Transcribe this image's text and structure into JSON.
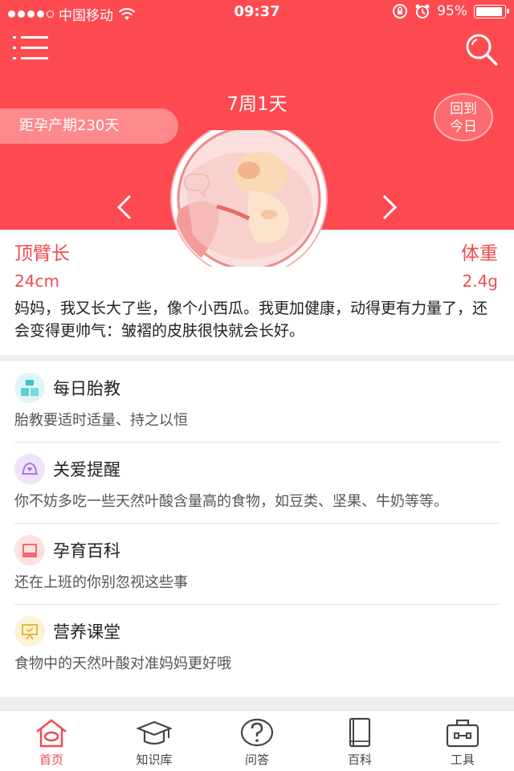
{
  "status_bar": {
    "carrier": "中国移动",
    "time": "09:37",
    "battery": "95%"
  },
  "header": {
    "week": "7周1天",
    "due_countdown": "距孕产期230天",
    "back_today": "回到今日"
  },
  "measurements": {
    "length_label": "顶臂长",
    "length_value": "24cm",
    "weight_label": "体重",
    "weight_value": "2.4g"
  },
  "description": "妈妈，我又长大了些，像个小西瓜。我更加健康，动得更有力量了，还会变得更帅气：皱褶的皮肤很快就会长好。",
  "cards": [
    {
      "title": "每日胎教",
      "subtitle": "胎教要适时适量、持之以恒",
      "icon": "building-blocks-icon",
      "color": "#37c6c9"
    },
    {
      "title": "关爱提醒",
      "subtitle": "你不妨多吃一些天然叶酸含量高的食物，如豆类、坚果、牛奶等等。",
      "icon": "bell-heart-icon",
      "color": "#a77bd6"
    },
    {
      "title": "孕育百科",
      "subtitle": "还在上班的你别忽视这些事",
      "icon": "book-icon",
      "color": "#f06a6f"
    },
    {
      "title": "营养课堂",
      "subtitle": "食物中的天然叶酸对准妈妈更好哦",
      "icon": "presentation-icon",
      "color": "#e8b540"
    }
  ],
  "tabs": [
    {
      "label": "首页",
      "icon": "home-icon",
      "active": true
    },
    {
      "label": "知识库",
      "icon": "graduation-cap-icon",
      "active": false
    },
    {
      "label": "问答",
      "icon": "question-icon",
      "active": false
    },
    {
      "label": "百科",
      "icon": "book-icon",
      "active": false
    },
    {
      "label": "工具",
      "icon": "toolbox-icon",
      "active": false
    }
  ],
  "colors": {
    "accent": "#fd4a50",
    "text": "#222222"
  }
}
